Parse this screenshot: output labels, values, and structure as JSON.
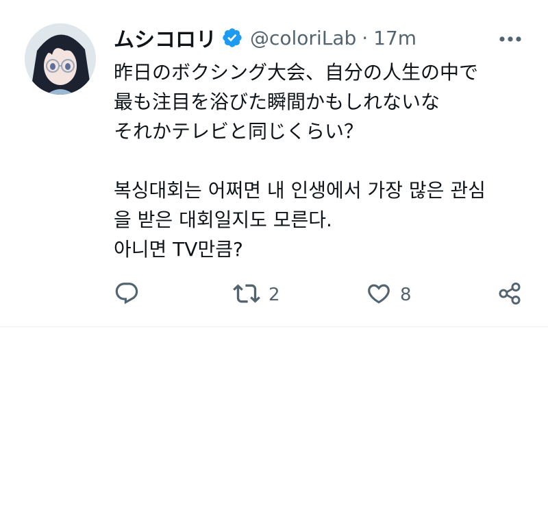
{
  "tweet": {
    "display_name": "ムシコロリ",
    "handle": "@coloriLab",
    "separator": "·",
    "time": "17m",
    "text_lines_ja": [
      "昨日のボクシング大会、自分の人生の中で",
      "最も注目を浴びた瞬間かもしれないな",
      "それかテレビと同じくらい？"
    ],
    "text_lines_ko": [
      "복싱대회는 어쩌면 내 인생에서 가장 많은 관심",
      "을 받은 대회일지도 모른다.",
      "아니면 TV만큼?"
    ],
    "retweet_count": "2",
    "like_count": "8"
  },
  "icons": {
    "verified": "verified-badge-icon",
    "more": "more-dots-icon",
    "reply": "reply-icon",
    "retweet": "retweet-icon",
    "like": "heart-icon",
    "share": "share-icon"
  },
  "colors": {
    "verified_blue": "#1d9bf0",
    "secondary_text": "#536471",
    "primary_text": "#0f1419"
  }
}
